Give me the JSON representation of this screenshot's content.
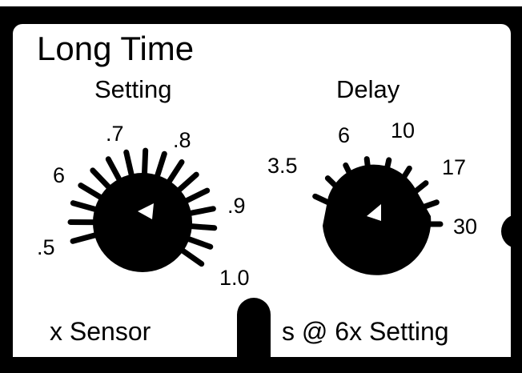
{
  "title": "Long Time",
  "setting_dial": {
    "heading": "Setting",
    "scale": [
      ".5",
      "6",
      ".7",
      ".8",
      ".9",
      "1.0"
    ],
    "unit": "x Sensor"
  },
  "delay_dial": {
    "heading": "Delay",
    "scale": [
      "3.5",
      "6",
      "10",
      "17",
      "30"
    ],
    "unit": "s @ 6x Setting"
  },
  "colors": {
    "background": "#000000",
    "panel": "#ffffff",
    "ink": "#000000"
  }
}
